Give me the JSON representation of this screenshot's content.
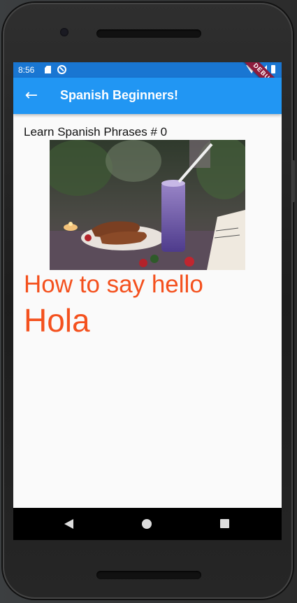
{
  "status_bar": {
    "time": "8:56",
    "debug_label": "DEBUG"
  },
  "app_bar": {
    "back_icon": "arrow-back-icon",
    "title": "Spanish Beginners!"
  },
  "lesson": {
    "header": "Learn Spanish Phrases # 0",
    "english": "How to say hello",
    "spanish": "Hola"
  },
  "colors": {
    "app_bar": "#2196f3",
    "status_bar": "#1976d2",
    "phrase_text": "#f4511e"
  }
}
